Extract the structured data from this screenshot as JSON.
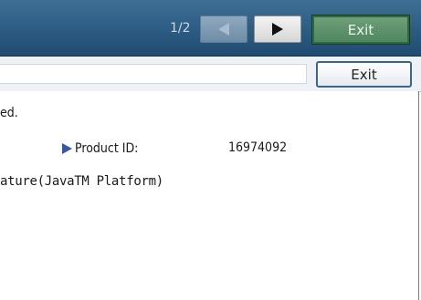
{
  "header": {
    "page_indicator": "1/2",
    "prev_icon": "triangle-left-icon",
    "next_icon": "triangle-right-icon",
    "exit_label": "Exit"
  },
  "toolbar": {
    "exit_label": "Exit"
  },
  "content": {
    "line1": "ed.",
    "product_id_label": "Product ID:",
    "product_id_value": "16974092",
    "line3": "ature(JavaTM Platform)"
  },
  "colors": {
    "header_bg": "#2f5f86",
    "exit_top_bg": "#5a8f69",
    "bullet": "#3658a6"
  }
}
